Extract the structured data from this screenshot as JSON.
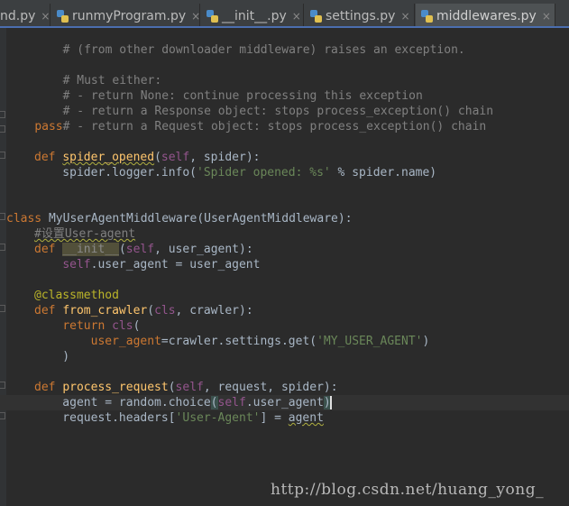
{
  "tabs": [
    {
      "label": "nd.py",
      "active": false,
      "close": "×"
    },
    {
      "label": "runmyProgram.py",
      "active": false,
      "close": "×"
    },
    {
      "label": "__init__.py",
      "active": false,
      "close": "×"
    },
    {
      "label": "settings.py",
      "active": false,
      "close": "×"
    },
    {
      "label": "middlewares.py",
      "active": true,
      "close": "×"
    }
  ],
  "code": {
    "l1": {
      "a": "    # (from other downloader middleware) raises an exception."
    },
    "l3": {
      "a": "    # Must either:"
    },
    "l4": {
      "a": "    # - return None: continue processing this exception"
    },
    "l5": {
      "a": "    # - return a Response object: stops process_exception() chain"
    },
    "l6": {
      "a": "    # - return a Request object: stops process_exception() chain"
    },
    "l7": {
      "a": "    ",
      "b": "pass"
    },
    "l9": {
      "a": "def ",
      "b": "spider_opened",
      "c": "(",
      "d": "self",
      "e": ", spider):"
    },
    "l10": {
      "a": "    spider.logger.info(",
      "b": "'Spider opened: %s'",
      "c": " % spider.name)"
    },
    "l13": {
      "a": "class ",
      "b": "MyUserAgentMiddleware(UserAgentMiddleware):"
    },
    "l14": {
      "a": "#设置User-agent"
    },
    "l15": {
      "a": "def ",
      "b": "__init__",
      "c": "(",
      "d": "self",
      "e": ", user_agent):"
    },
    "l16": {
      "a": "    ",
      "b": "self",
      "c": ".user_agent = user_agent"
    },
    "l18": {
      "a": "@classmethod"
    },
    "l19": {
      "a": "def ",
      "b": "from_crawler",
      "c": "(",
      "d": "cls",
      "e": ", crawler):"
    },
    "l20": {
      "a": "    ",
      "b": "return ",
      "c": "cls",
      "d": "("
    },
    "l21": {
      "a": "        ",
      "b": "user_agent",
      "c": "=crawler.settings.get(",
      "d": "'MY_USER_AGENT'",
      "e": ")"
    },
    "l22": {
      "a": "    )"
    },
    "l24": {
      "a": "def ",
      "b": "process_request",
      "c": "(",
      "d": "self",
      "e": ", request, spider):"
    },
    "l25": {
      "a": "    agent = random.choice",
      "b": "(",
      "c": "self",
      "d": ".user_agent",
      "e": ")"
    },
    "l26": {
      "a": "    request.headers[",
      "b": "'User-Agent'",
      "c": "] = ",
      "d": "agent"
    }
  },
  "watermark": "http://blog.csdn.net/huang_yong_"
}
